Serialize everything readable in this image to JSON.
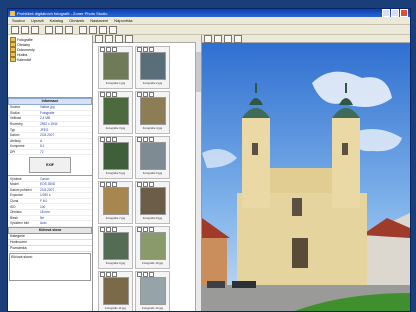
{
  "window": {
    "title": "Prohlížeč digitálních fotografií - Zoner Photo Studio"
  },
  "menu": [
    "Soubor",
    "Upravit",
    "Katalog",
    "Obrázek",
    "Nastavení",
    "Nápověda"
  ],
  "tree": [
    "Fotografie",
    "Obrázky",
    "Dokumenty",
    "Hudba",
    "Kalendář"
  ],
  "info": {
    "header": "Informace",
    "rows": [
      {
        "k": "Soubor",
        "v": "Valtice.jpg"
      },
      {
        "k": "Složka",
        "v": "Fotografie"
      },
      {
        "k": "Velikost",
        "v": "2,4 MB"
      },
      {
        "k": "Rozměry",
        "v": "2592 x 1944"
      },
      {
        "k": "Typ",
        "v": "JPEG"
      },
      {
        "k": "Datum",
        "v": "23.8.2007"
      },
      {
        "k": "Atributy",
        "v": "A"
      },
      {
        "k": "Komprese",
        "v": "8:1"
      },
      {
        "k": "DPI",
        "v": "72"
      }
    ]
  },
  "exif": {
    "title": "EXIF",
    "rows": [
      {
        "k": "Výrobce",
        "v": "Canon"
      },
      {
        "k": "Model",
        "v": "EOS 350D"
      },
      {
        "k": "Datum pořízení",
        "v": "23.8.2007"
      },
      {
        "k": "Expozice",
        "v": "1/250 s"
      },
      {
        "k": "Clona",
        "v": "F 8.0"
      },
      {
        "k": "ISO",
        "v": "100"
      },
      {
        "k": "Ohnisko",
        "v": "18 mm"
      },
      {
        "k": "Blesk",
        "v": "Ne"
      },
      {
        "k": "Vyvážení bílé",
        "v": "Auto"
      }
    ]
  },
  "keywords": {
    "rows": [
      "Klíčová slova",
      "Kategorie",
      "Hodnocení",
      "Poznámka"
    ],
    "box_label": "Klíčová slova:"
  },
  "thumbs": [
    {
      "cap": "Fotografie 1.jpg",
      "c": "#6f7a58"
    },
    {
      "cap": "Fotografie 2.jpg",
      "c": "#5a6e7a"
    },
    {
      "cap": "Fotografie 3.jpg",
      "c": "#4c6a3e"
    },
    {
      "cap": "Fotografie 4.jpg",
      "c": "#8c7d55"
    },
    {
      "cap": "Fotografie 5.jpg",
      "c": "#3f5f3a"
    },
    {
      "cap": "Fotografie 6.jpg",
      "c": "#7e8b92"
    },
    {
      "cap": "Fotografie 7.jpg",
      "c": "#a7864f"
    },
    {
      "cap": "Fotografie 8.jpg",
      "c": "#6b5d48"
    },
    {
      "cap": "Fotografie 9.jpg",
      "c": "#556c54"
    },
    {
      "cap": "Fotografie 10.jpg",
      "c": "#8a9a6a"
    },
    {
      "cap": "Fotografie 11.jpg",
      "c": "#7a6a4a"
    },
    {
      "cap": "Fotografie 12.jpg",
      "c": "#96a3a8"
    }
  ],
  "colors": {
    "titlebar": "#0a3fa8",
    "background": "#1a3f78",
    "sky": "#5d95de",
    "church": "#e7d6a0"
  }
}
